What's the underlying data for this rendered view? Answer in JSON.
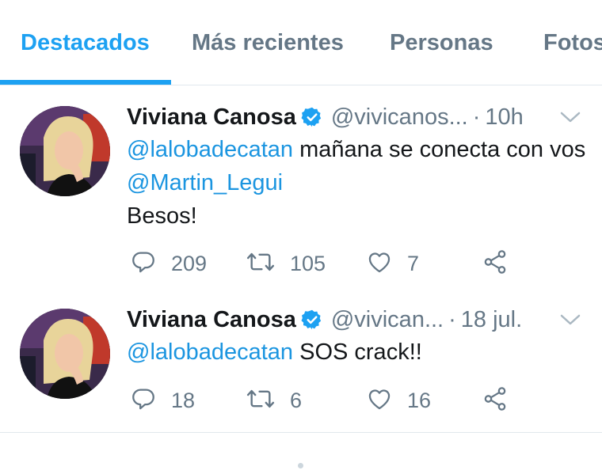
{
  "tabs": [
    {
      "label": "Destacados",
      "active": true
    },
    {
      "label": "Más recientes",
      "active": false
    },
    {
      "label": "Personas",
      "active": false
    },
    {
      "label": "Fotos",
      "active": false
    }
  ],
  "colors": {
    "accent": "#1da1f2",
    "mention": "#1b95e0",
    "muted": "#657786",
    "text": "#14171a",
    "divider": "#e1e8ed"
  },
  "tweets": [
    {
      "name": "Viviana Canosa",
      "handle": "@vivicanos...",
      "dot": "·",
      "time": "10h",
      "text_parts": {
        "mention1": "@lalobadecatan",
        "text1": " mañana se conecta con vos ",
        "mention2": "@Martin_Legui",
        "text2": "Besos!"
      },
      "replies": "209",
      "retweets": "105",
      "likes": "7",
      "icons": [
        "reply-icon",
        "retweet-icon",
        "like-icon",
        "share-icon",
        "verified-icon",
        "chevron-down-icon"
      ]
    },
    {
      "name": "Viviana Canosa",
      "handle": "@vivican...",
      "dot": "·",
      "time": "18 jul.",
      "text_parts": {
        "mention1": "@lalobadecatan",
        "text1": " SOS crack!!"
      },
      "replies": "18",
      "retweets": "6",
      "likes": "16",
      "icons": [
        "reply-icon",
        "retweet-icon",
        "like-icon",
        "share-icon",
        "verified-icon",
        "chevron-down-icon"
      ]
    }
  ]
}
